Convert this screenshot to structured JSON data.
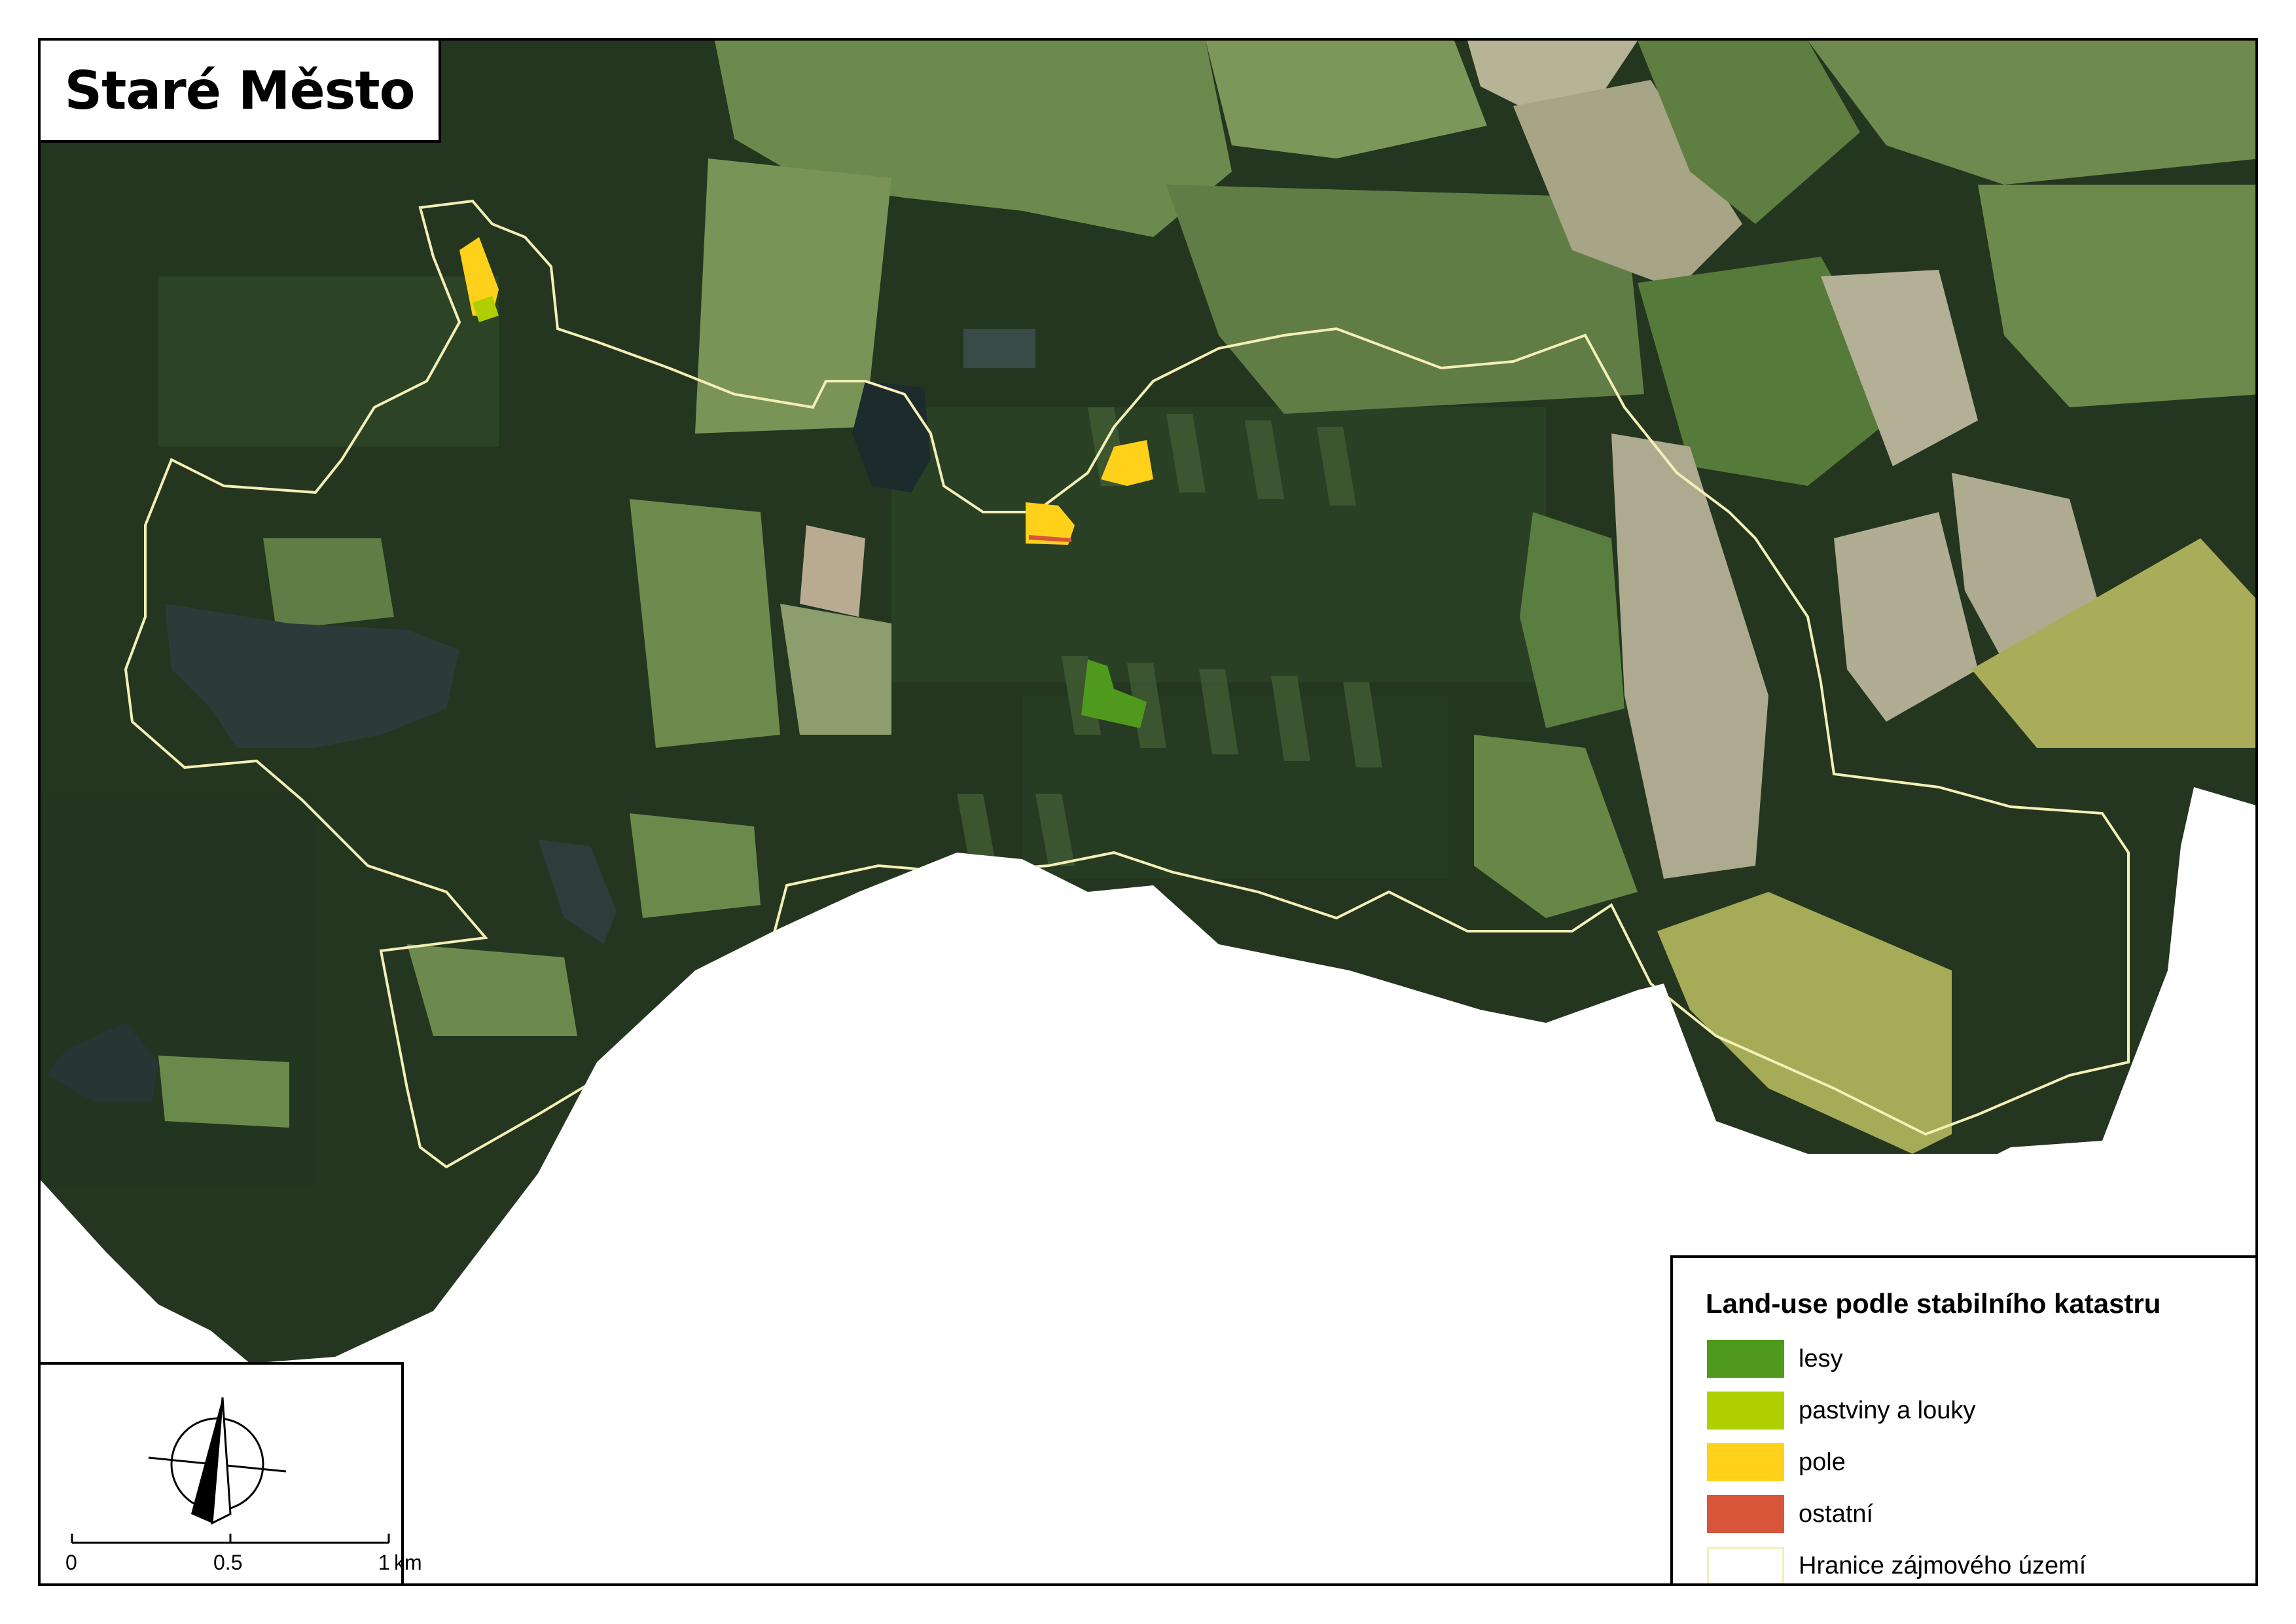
{
  "map": {
    "title": "Staré Město",
    "colors": {
      "forest_dark": "#24361f",
      "forest_mid": "#2e4527",
      "meadow": "#6f8a4f",
      "meadow_light": "#8aa06a",
      "field_beige": "#a7a68a",
      "field_yellow": "#a9ad5a",
      "water": "#2b3a3a",
      "boundary": "#f3efb6"
    }
  },
  "legend": {
    "title": "Land-use podle stabilního katastru",
    "items": [
      {
        "label": "lesy",
        "color": "#4f9a1d"
      },
      {
        "label": "pastviny a louky",
        "color": "#afcf00"
      },
      {
        "label": "pole",
        "color": "#ffd11a"
      },
      {
        "label": "ostatní",
        "color": "#d9553a"
      },
      {
        "label": "Hranice zájmového území",
        "color": "#ffffff",
        "border": "#f3efb6"
      }
    ]
  },
  "scale_bar": {
    "ticks": [
      "0",
      "0.5",
      "1"
    ],
    "unit": "km"
  },
  "north_arrow": {
    "icon": "north-arrow-icon"
  }
}
